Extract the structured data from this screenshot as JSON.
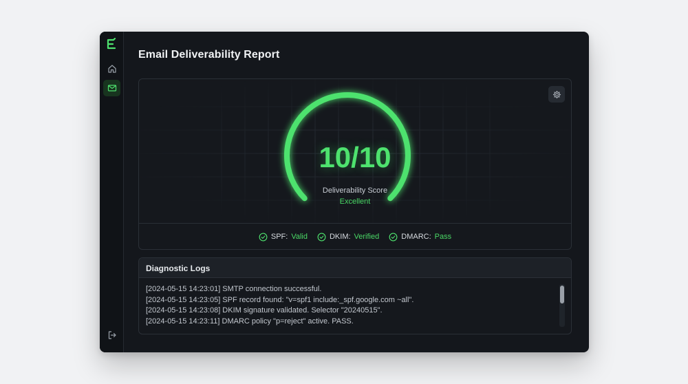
{
  "app": {
    "title": "Email Deliverability Report"
  },
  "sidebar": {
    "items": [
      {
        "name": "home",
        "icon": "home-icon",
        "active": false
      },
      {
        "name": "mail",
        "icon": "mail-icon",
        "active": true
      }
    ],
    "logout_icon": "logout-icon",
    "logo_icon": "brand-logo-icon"
  },
  "score": {
    "value": "10/10",
    "label": "Deliverability Score",
    "grade": "Excellent",
    "fraction": 1.0
  },
  "checks": [
    {
      "name": "SPF:",
      "status": "Valid"
    },
    {
      "name": "DKIM:",
      "status": "Verified"
    },
    {
      "name": "DMARC:",
      "status": "Pass"
    }
  ],
  "logs": {
    "title": "Diagnostic Logs",
    "lines": [
      "[2024-05-15 14:23:01] SMTP connection successful.",
      "[2024-05-15 14:23:05] SPF record found: \"v=spf1 include:_spf.google.com ~all\".",
      "[2024-05-15 14:23:08] DKIM signature validated. Selector \"20240515\".",
      "[2024-05-15 14:23:11] DMARC policy \"p=reject\" active. PASS."
    ]
  },
  "colors": {
    "accent": "#4ee26e",
    "background": "#14171c",
    "page": "#f1f2f4"
  }
}
